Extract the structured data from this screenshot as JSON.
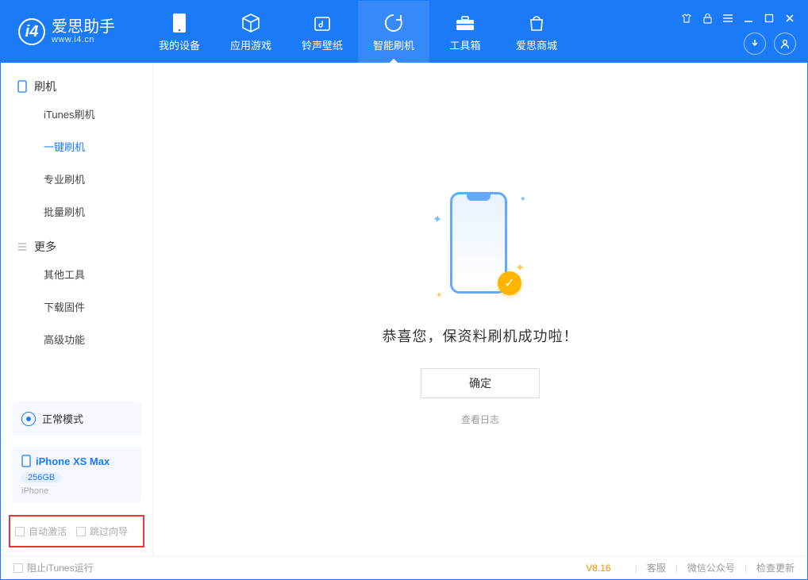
{
  "app": {
    "title": "爱思助手",
    "subtitle": "www.i4.cn"
  },
  "nav": {
    "items": [
      {
        "label": "我的设备"
      },
      {
        "label": "应用游戏"
      },
      {
        "label": "铃声壁纸"
      },
      {
        "label": "智能刷机"
      },
      {
        "label": "工具箱"
      },
      {
        "label": "爱思商城"
      }
    ],
    "active_index": 3
  },
  "sidebar": {
    "group_flash": "刷机",
    "flash_items": [
      "iTunes刷机",
      "一键刷机",
      "专业刷机",
      "批量刷机"
    ],
    "flash_active_index": 1,
    "group_more": "更多",
    "more_items": [
      "其他工具",
      "下载固件",
      "高级功能"
    ],
    "mode_label": "正常模式",
    "device": {
      "name": "iPhone XS Max",
      "capacity": "256GB",
      "type": "iPhone"
    },
    "auto_activate": "自动激活",
    "skip_guide": "跳过向导"
  },
  "main": {
    "success_text": "恭喜您，保资料刷机成功啦！",
    "ok_button": "确定",
    "view_log": "查看日志"
  },
  "footer": {
    "block_itunes": "阻止iTunes运行",
    "version": "V8.16",
    "links": [
      "客服",
      "微信公众号",
      "检查更新"
    ]
  }
}
